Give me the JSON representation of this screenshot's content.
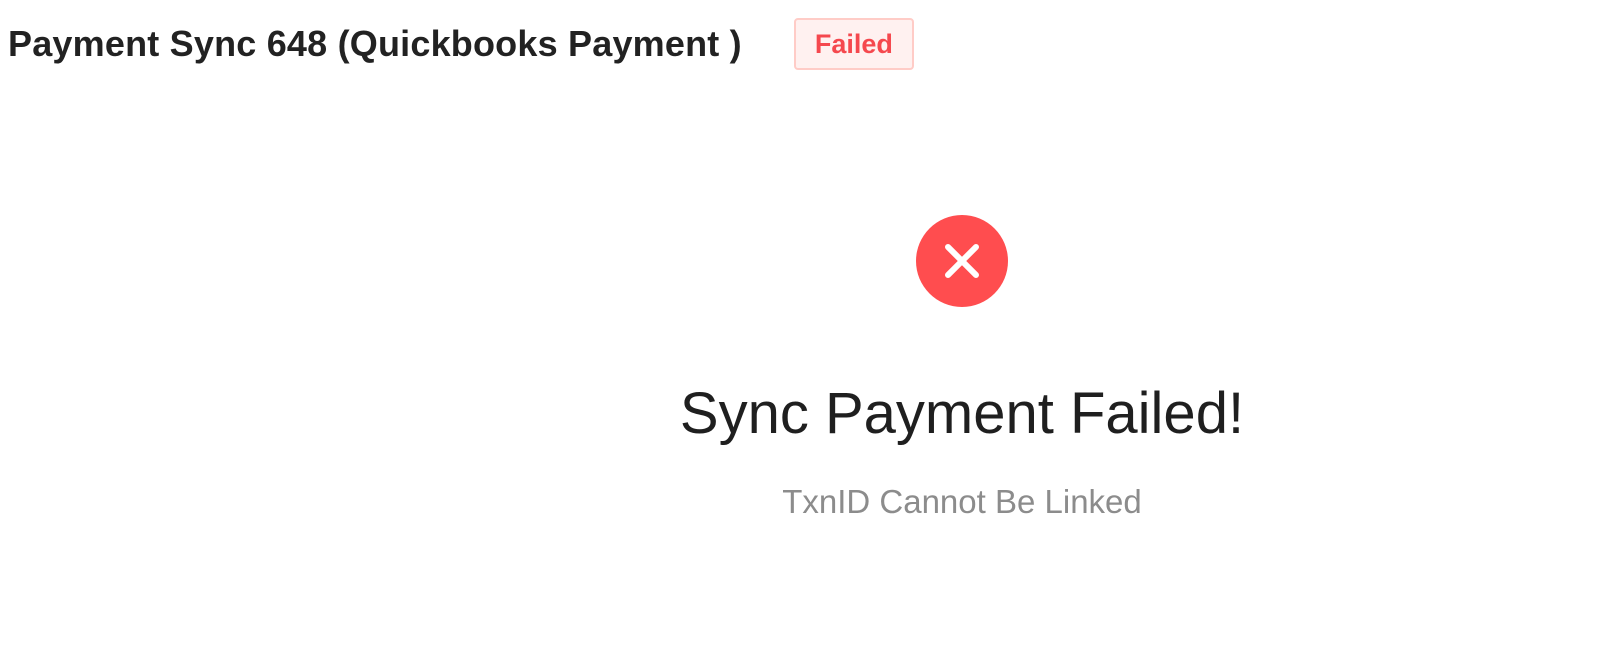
{
  "header": {
    "title": "Payment Sync 648 (Quickbooks Payment )",
    "status_badge": "Failed"
  },
  "result": {
    "icon": "close-circle-icon",
    "title": "Sync Payment Failed!",
    "subtitle": "TxnID Cannot Be Linked"
  },
  "colors": {
    "error": "#ff4d4f",
    "badge_background": "#fff1f0",
    "badge_border": "#ffccc7",
    "badge_text": "#f5484e",
    "title_text": "#1f1f1f",
    "subtitle_text": "#8c8c8c"
  }
}
